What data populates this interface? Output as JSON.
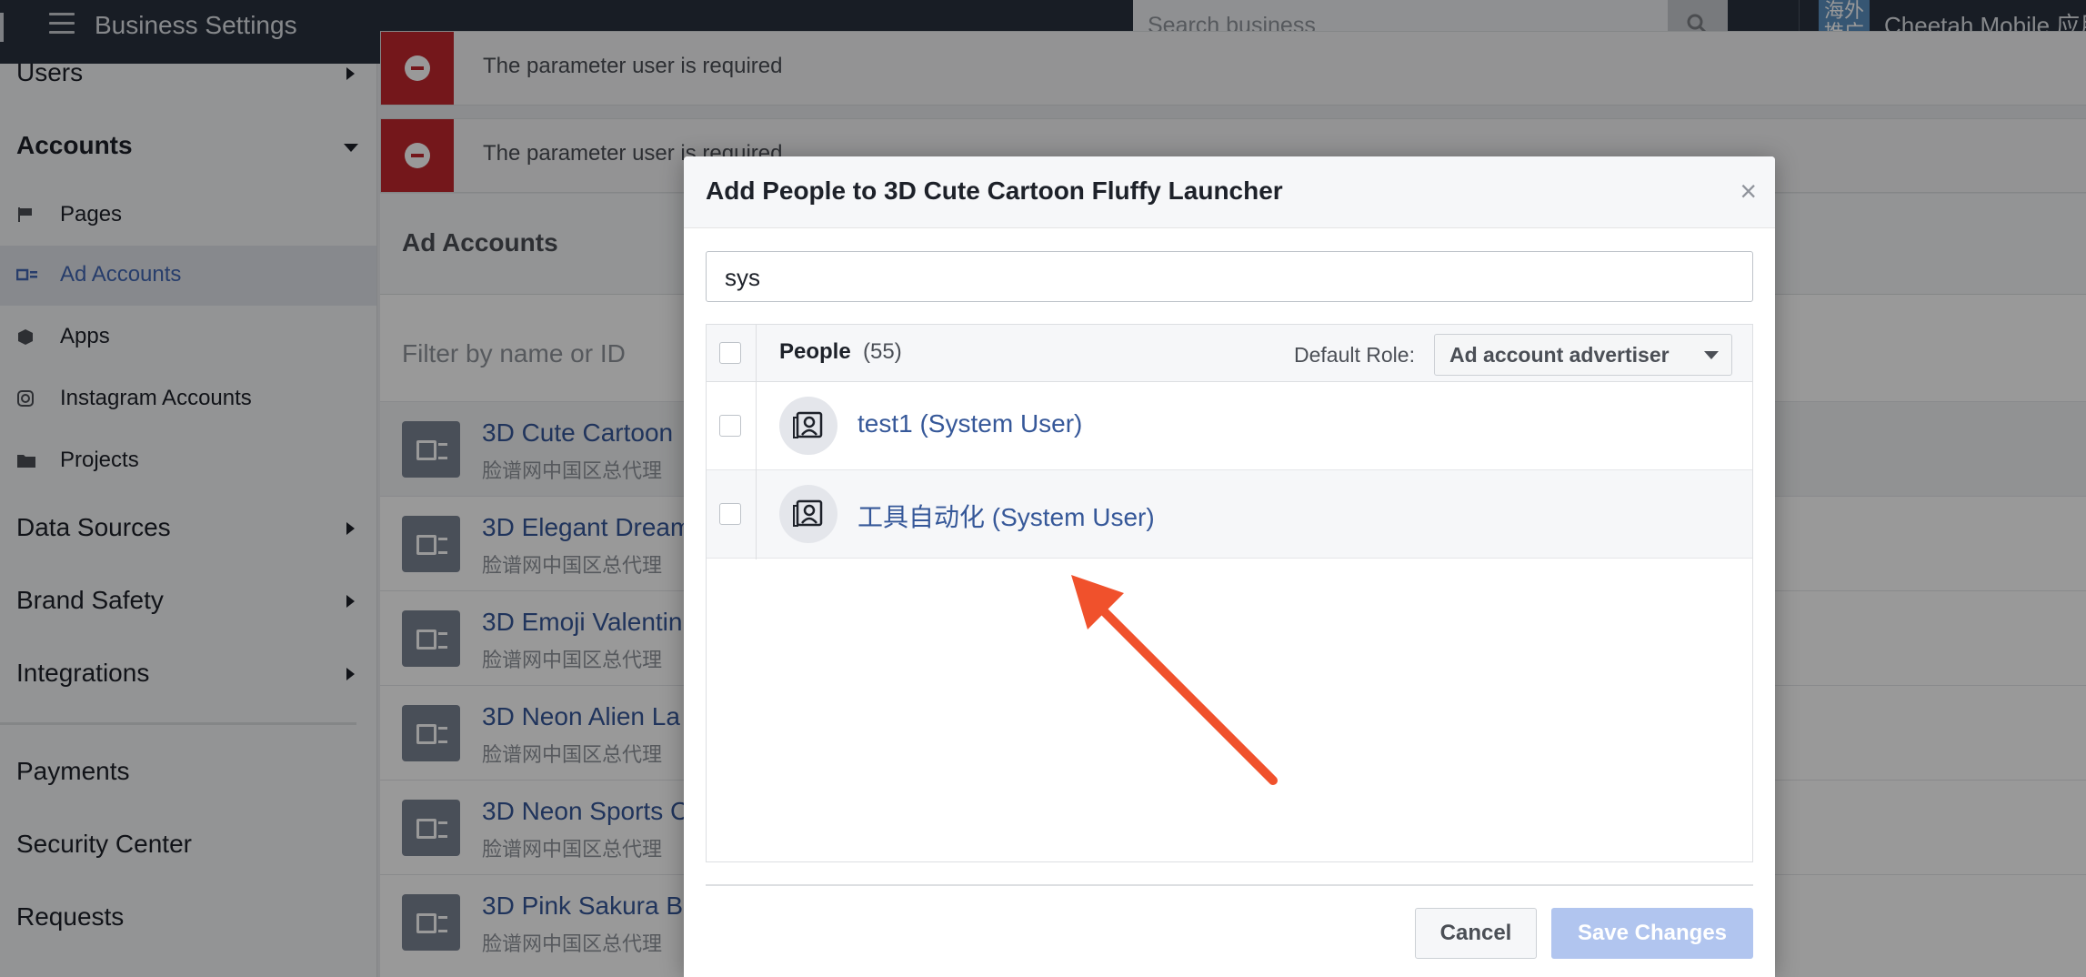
{
  "topbar": {
    "title": "Business Settings",
    "search_placeholder": "Search business",
    "business_name": "Cheetah Mobile 应用",
    "business_avatar_text": "海外推广"
  },
  "sidebar": {
    "users": "Users",
    "accounts": "Accounts",
    "items": [
      {
        "label": "Pages",
        "icon": "flag-icon"
      },
      {
        "label": "Ad Accounts",
        "icon": "ad-account-icon",
        "active": true
      },
      {
        "label": "Apps",
        "icon": "cube-icon"
      },
      {
        "label": "Instagram Accounts",
        "icon": "instagram-icon"
      },
      {
        "label": "Projects",
        "icon": "folder-icon"
      }
    ],
    "data_sources": "Data Sources",
    "brand_safety": "Brand Safety",
    "integrations": "Integrations",
    "payments": "Payments",
    "security_center": "Security Center",
    "requests": "Requests"
  },
  "errors": [
    "The parameter user is required",
    "The parameter user is required"
  ],
  "panel": {
    "title": "Ad Accounts",
    "filter_placeholder": "Filter by name or ID",
    "rows": [
      {
        "name": "3D Cute Cartoon",
        "sub": "脸谱网中国区总代理"
      },
      {
        "name": "3D Elegant Dream",
        "sub": "脸谱网中国区总代理"
      },
      {
        "name": "3D Emoji Valentin",
        "sub": "脸谱网中国区总代理"
      },
      {
        "name": "3D Neon Alien La",
        "sub": "脸谱网中国区总代理"
      },
      {
        "name": "3D Neon Sports C",
        "sub": "脸谱网中国区总代理"
      },
      {
        "name": "3D Pink Sakura B",
        "sub": "脸谱网中国区总代理"
      }
    ]
  },
  "modal": {
    "title": "Add People to 3D Cute Cartoon Fluffy Launcher",
    "close": "×",
    "search_value": "sys",
    "people_label": "People",
    "people_count": "(55)",
    "default_role_label": "Default Role:",
    "default_role_value": "Ad account advertiser",
    "people": [
      {
        "name": "test1 (System User)"
      },
      {
        "name": "工具自动化 (System User)"
      }
    ],
    "cancel": "Cancel",
    "save": "Save Changes"
  },
  "colors": {
    "topbar": "#29313e",
    "link": "#365899",
    "error": "#c2272d",
    "arrow": "#f0512c",
    "save_disabled": "#b1c5ef"
  }
}
